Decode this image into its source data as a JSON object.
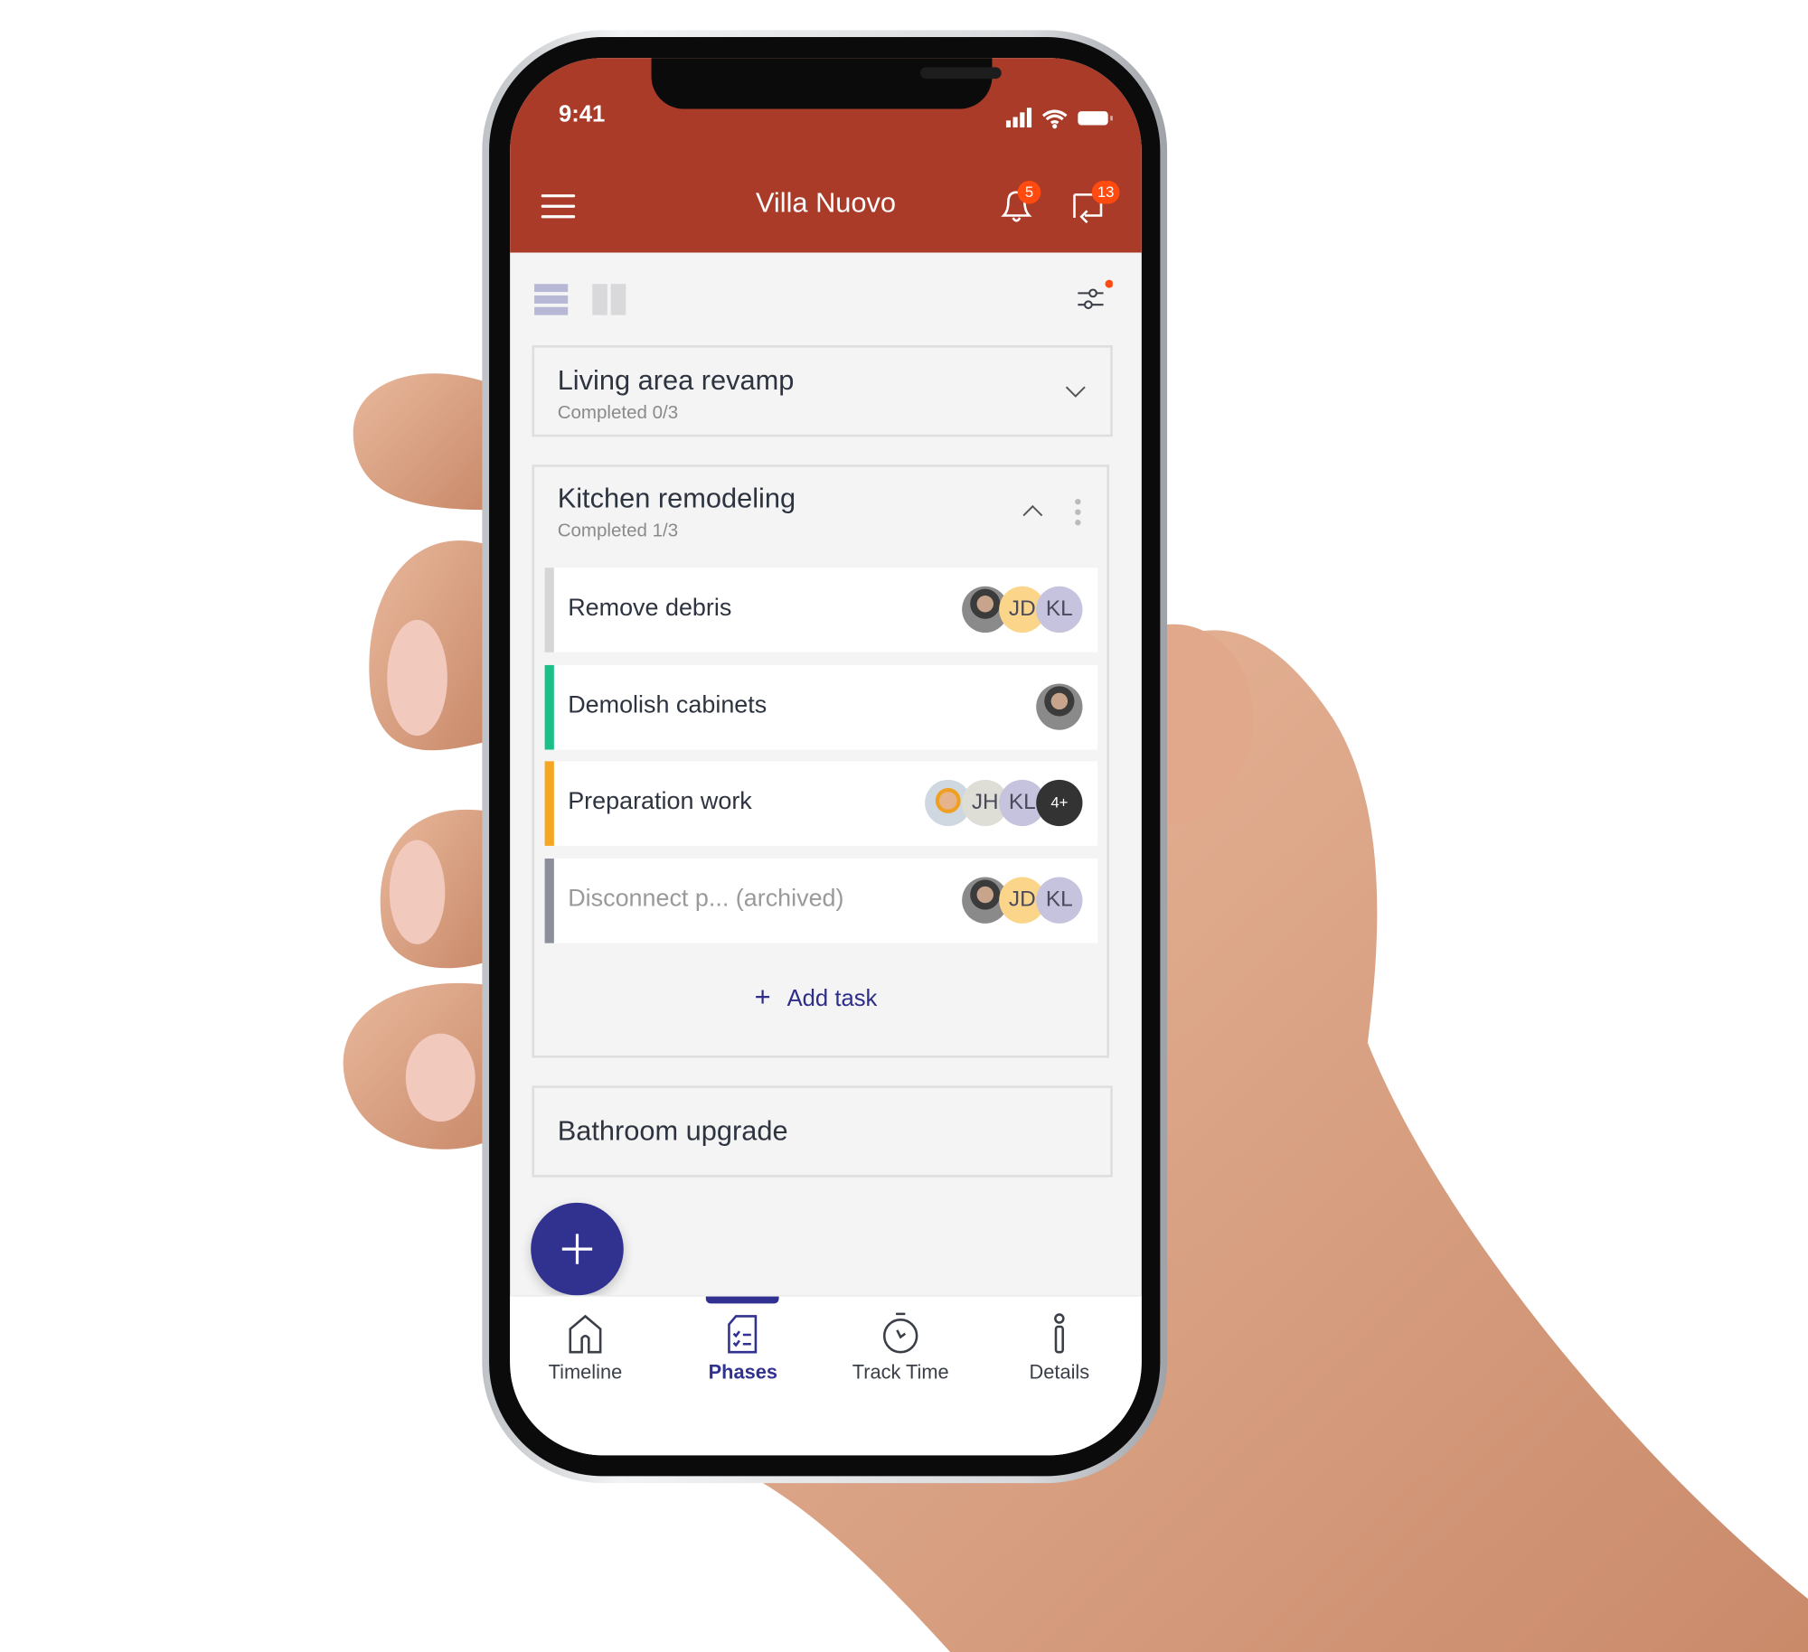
{
  "status_bar": {
    "time": "9:41"
  },
  "header": {
    "title": "Villa Nuovo",
    "notifications_count": "5",
    "messages_count": "13",
    "accent": "#a93b28"
  },
  "toolbar": {
    "views": [
      "list-view",
      "board-view"
    ],
    "filter_active": true
  },
  "phases": [
    {
      "title": "Living area revamp",
      "subtitle": "Completed 0/3",
      "expanded": false
    },
    {
      "title": "Kitchen remodeling",
      "subtitle": "Completed 1/3",
      "expanded": true,
      "tasks": [
        {
          "name": "Remove debris",
          "status_color": "#d6d6d6",
          "assignees": [
            "photo",
            "JD",
            "KL"
          ]
        },
        {
          "name": "Demolish cabinets",
          "status_color": "#1bbf8a",
          "assignees": [
            "photo"
          ]
        },
        {
          "name": "Preparation work",
          "status_color": "#f5a623",
          "assignees": [
            "photo",
            "JH",
            "KL",
            "4+"
          ]
        },
        {
          "name": "Disconnect p... (archived)",
          "status_color": "#8a8f99",
          "assignees": [
            "photo",
            "JD",
            "KL"
          ]
        }
      ],
      "add_task_label": "Add task"
    },
    {
      "title": "Bathroom upgrade"
    }
  ],
  "bottom_nav": [
    {
      "label": "Timeline",
      "icon": "house-icon"
    },
    {
      "label": "Phases",
      "icon": "checklist-icon",
      "active": true
    },
    {
      "label": "Track Time",
      "icon": "stopwatch-icon"
    },
    {
      "label": "Details",
      "icon": "info-icon"
    }
  ],
  "colors": {
    "primary": "#313190",
    "header": "#a93b28",
    "badge": "#ff4a10"
  }
}
